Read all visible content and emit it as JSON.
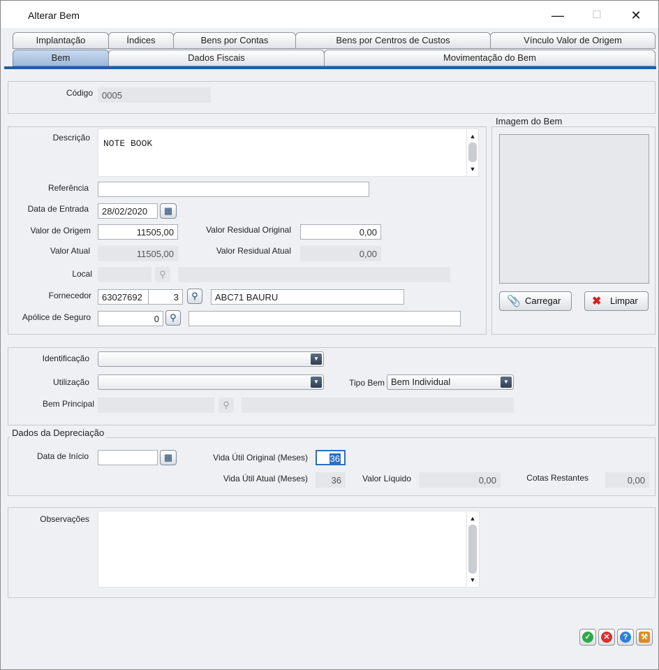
{
  "window": {
    "title": "Alterar Bem",
    "minimize_glyph": "—",
    "maximize_glyph": "☐",
    "close_glyph": "✕"
  },
  "tabs_row1": [
    "Implantação",
    "Índices",
    "Bens por Contas",
    "Bens por Centros de Custos",
    "Vínculo Valor de Origem"
  ],
  "tabs_row2": [
    "Bem",
    "Dados Fiscais",
    "Movimentação do Bem"
  ],
  "active_tab": "Bem",
  "codigo": {
    "label": "Código",
    "value": "0005"
  },
  "descricao": {
    "label": "Descrição",
    "value": "NOTE BOOK"
  },
  "referencia": {
    "label": "Referência",
    "value": ""
  },
  "data_entrada": {
    "label": "Data de Entrada",
    "value": "28/02/2020"
  },
  "valor_origem": {
    "label": "Valor de Origem",
    "value": "11505,00"
  },
  "valor_residual_original": {
    "label": "Valor Residual Original",
    "value": "0,00"
  },
  "valor_atual": {
    "label": "Valor Atual",
    "value": "11505,00"
  },
  "valor_residual_atual": {
    "label": "Valor Residual Atual",
    "value": "0,00"
  },
  "local": {
    "label": "Local",
    "value": "",
    "desc": ""
  },
  "fornecedor": {
    "label": "Fornecedor",
    "code": "63027692",
    "seq": "3",
    "name": "ABC71 BAURU"
  },
  "apolice": {
    "label": "Apólice de Seguro",
    "value": "0",
    "desc": ""
  },
  "imagem": {
    "legend": "Imagem do Bem",
    "carregar_label": "Carregar",
    "limpar_label": "Limpar"
  },
  "identificacao": {
    "label": "Identificação",
    "value": ""
  },
  "utilizacao": {
    "label": "Utilização",
    "value": ""
  },
  "tipo_bem": {
    "label": "Tipo Bem",
    "value": "Bem Individual"
  },
  "bem_principal": {
    "label": "Bem Principal",
    "value": "",
    "desc": ""
  },
  "depreciacao": {
    "legend": "Dados da Depreciação",
    "data_inicio_label": "Data de Início",
    "data_inicio_value": "",
    "vida_util_original_label": "Vida Útil Original (Meses)",
    "vida_util_original_value": "36",
    "vida_util_atual_label": "Vida Útil Atual (Meses)",
    "vida_util_atual_value": "36",
    "valor_liquido_label": "Valor Líquido",
    "valor_liquido_value": "0,00",
    "cotas_restantes_label": "Cotas Restantes",
    "cotas_restantes_value": "0,00"
  },
  "observacoes": {
    "label": "Observações",
    "value": ""
  },
  "footer_icons": [
    "check-icon",
    "cancel-icon",
    "help-icon",
    "wrench-icon"
  ],
  "colors": {
    "tab_active": "#9fb9d9",
    "tab_underline": "#1e5fa8",
    "ok": "#2fa84a",
    "cancel": "#d9302f",
    "help": "#2f7fd6",
    "tool": "#e08a1e"
  }
}
